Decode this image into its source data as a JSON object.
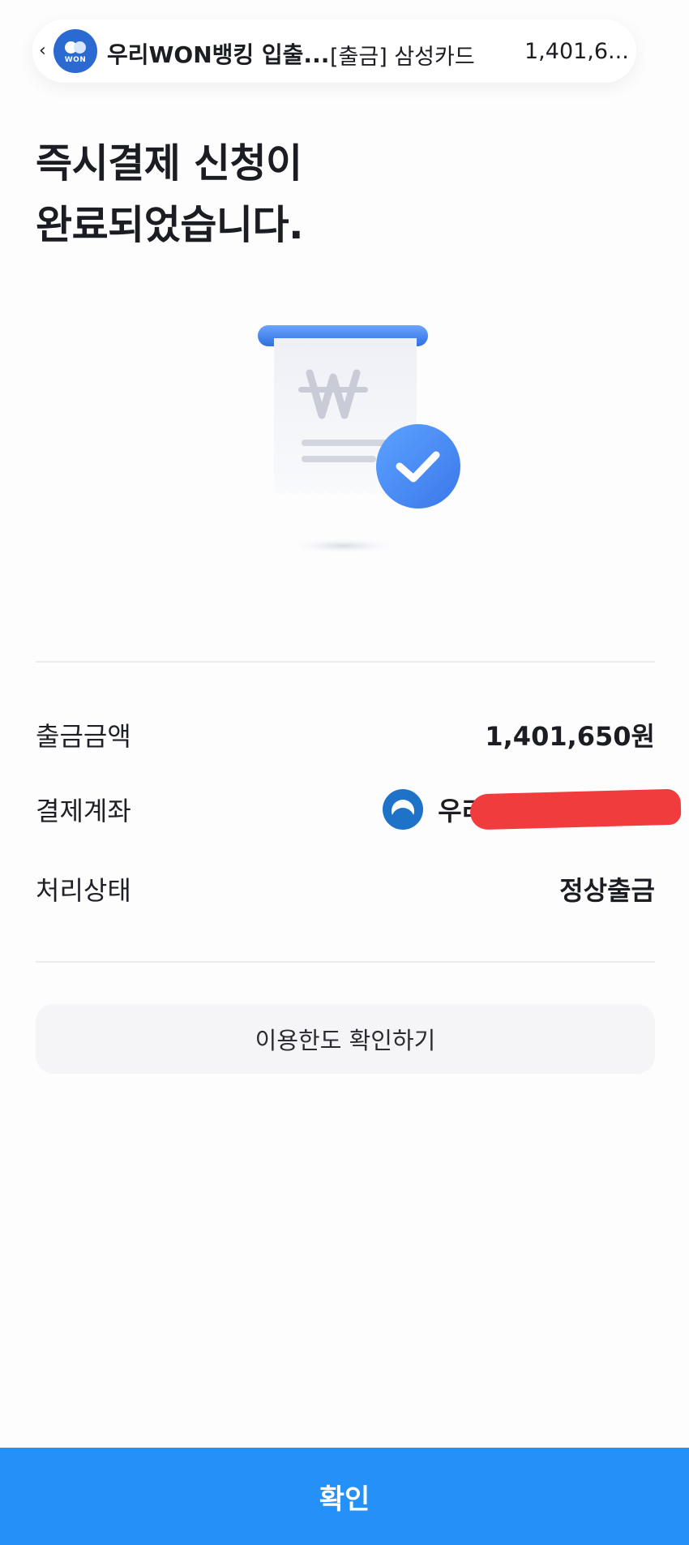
{
  "notification": {
    "app_name": "우리WON뱅킹 입출...",
    "message": "[출금] 삼성카드",
    "amount": "1,401,6...",
    "logo_text": "WON"
  },
  "title": {
    "line1": "즉시결제 신청이",
    "line2": "완료되었습니다."
  },
  "details": {
    "amount_label": "출금금액",
    "amount_value": "1,401,650원",
    "account_label": "결제계좌",
    "account_bank": "우리은행",
    "status_label": "처리상태",
    "status_value": "정상출금"
  },
  "buttons": {
    "limit_label": "이용한도 확인하기",
    "confirm_label": "확인"
  },
  "colors": {
    "accent": "#2490f8",
    "check_badge": "#3d86ef",
    "redaction": "#f03c3c"
  },
  "icons": {
    "receipt": "receipt-won-icon",
    "check": "check-circle-icon",
    "bank": "woori-bank-logo"
  }
}
